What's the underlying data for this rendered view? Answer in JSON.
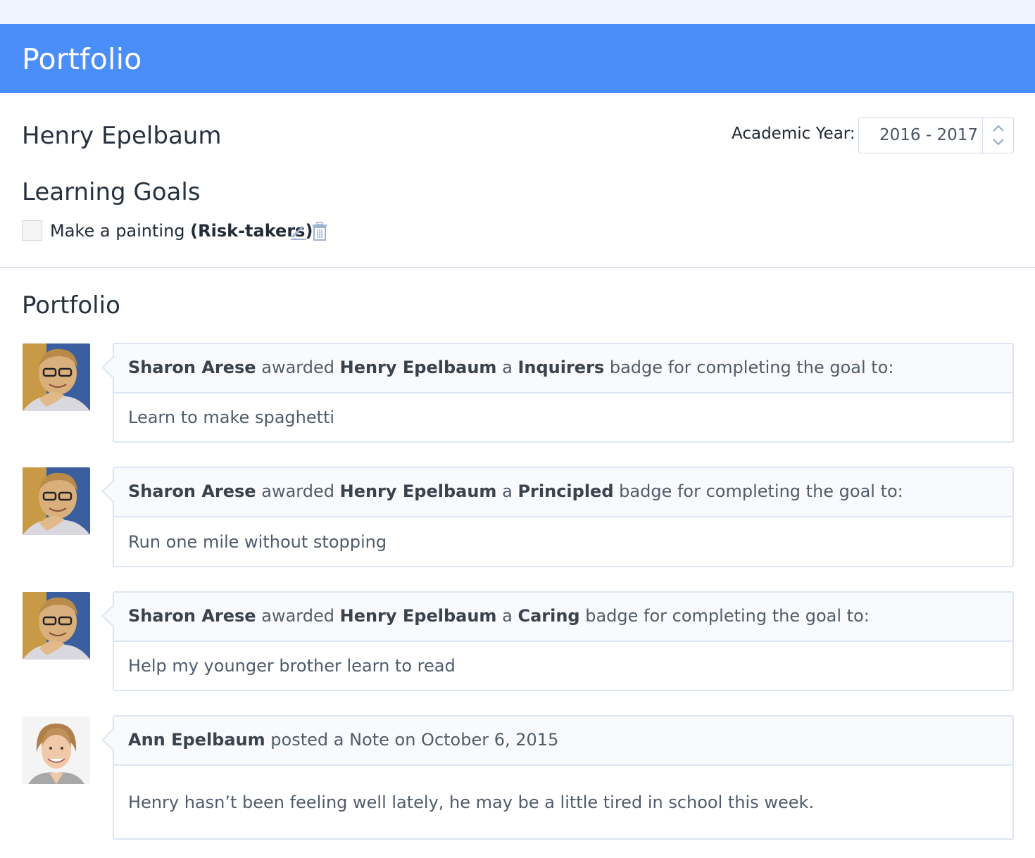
{
  "header": {
    "title": "Portfolio"
  },
  "student": {
    "name": "Henry Epelbaum"
  },
  "academic_year": {
    "label": "Academic Year:",
    "value": "2016 - 2017"
  },
  "learning_goals": {
    "heading": "Learning Goals",
    "items": [
      {
        "text": "Make a painting",
        "tag": "(Risk-takers)",
        "checked": false
      }
    ]
  },
  "portfolio": {
    "heading": "Portfolio",
    "entries": [
      {
        "actor": "Sharon Arese",
        "verb": "awarded",
        "recipient": "Henry Epelbaum",
        "article": "a",
        "badge": "Inquirers",
        "suffix": "badge for completing the goal to:",
        "body": "Learn to make spaghetti"
      },
      {
        "actor": "Sharon Arese",
        "verb": "awarded",
        "recipient": "Henry Epelbaum",
        "article": "a",
        "badge": "Principled",
        "suffix": "badge for completing the goal to:",
        "body": "Run one mile without stopping"
      },
      {
        "actor": "Sharon Arese",
        "verb": "awarded",
        "recipient": "Henry Epelbaum",
        "article": "a",
        "badge": "Caring",
        "suffix": "badge for completing the goal to:",
        "body": "Help my younger brother learn to read"
      },
      {
        "actor": "Ann Epelbaum",
        "action": "posted a Note on October 6, 2015",
        "body": "Henry hasn’t been feeling well lately, he may be a little tired in school this week."
      }
    ]
  },
  "colors": {
    "header": "#4a8ef9",
    "top_strip": "#eef4fd",
    "card_border": "#dde6f1",
    "card_head_bg": "#f8fafd"
  },
  "icons": {
    "edit": "pencil-icon",
    "delete": "trash-icon",
    "stepper": "chevron-up-down-icon"
  }
}
